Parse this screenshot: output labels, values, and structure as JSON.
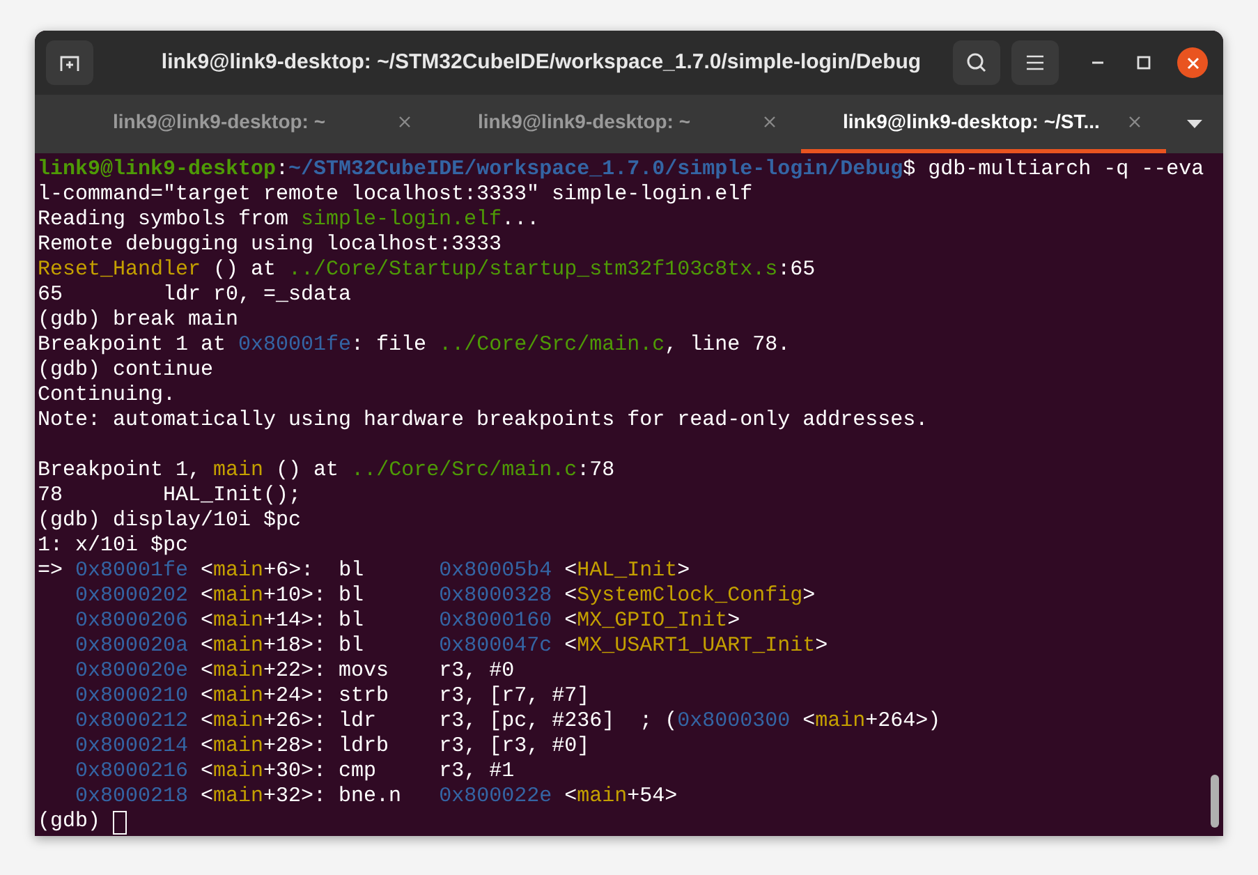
{
  "window": {
    "title": "link9@link9-desktop: ~/STM32CubeIDE/workspace_1.7.0/simple-login/Debug"
  },
  "tabs": [
    {
      "label": "link9@link9-desktop: ~",
      "selected": false
    },
    {
      "label": "link9@link9-desktop: ~",
      "selected": false
    },
    {
      "label": "link9@link9-desktop: ~/ST...",
      "selected": true
    }
  ],
  "terminal": {
    "lines": [
      {
        "kind": "text",
        "segments": [
          {
            "kind": "user",
            "text": "link9@link9-desktop"
          },
          {
            "kind": "plain",
            "text": ":"
          },
          {
            "kind": "path",
            "text": "~/STM32CubeIDE/workspace_1.7.0/simple-login/Debug"
          },
          {
            "kind": "plain",
            "text": "$ gdb-multiarch -q --eva"
          }
        ]
      },
      {
        "kind": "text",
        "segments": [
          {
            "kind": "plain",
            "text": "l-command=\"target remote localhost:3333\" simple-login.elf"
          }
        ]
      },
      {
        "kind": "text",
        "segments": [
          {
            "kind": "plain",
            "text": "Reading symbols from "
          },
          {
            "kind": "file",
            "text": "simple-login.elf"
          },
          {
            "kind": "plain",
            "text": "..."
          }
        ]
      },
      {
        "kind": "text",
        "segments": [
          {
            "kind": "plain",
            "text": "Remote debugging using localhost:3333"
          }
        ]
      },
      {
        "kind": "text",
        "segments": [
          {
            "kind": "symbol",
            "text": "Reset_Handler"
          },
          {
            "kind": "plain",
            "text": " () at "
          },
          {
            "kind": "file",
            "text": "../Core/Startup/startup_stm32f103c8tx.s"
          },
          {
            "kind": "plain",
            "text": ":65"
          }
        ]
      },
      {
        "kind": "text",
        "segments": [
          {
            "kind": "plain",
            "text": "65        ldr r0, =_sdata"
          }
        ]
      },
      {
        "kind": "text",
        "segments": [
          {
            "kind": "plain",
            "text": "(gdb) break main"
          }
        ]
      },
      {
        "kind": "text",
        "segments": [
          {
            "kind": "plain",
            "text": "Breakpoint 1 at "
          },
          {
            "kind": "address",
            "text": "0x80001fe"
          },
          {
            "kind": "plain",
            "text": ": file "
          },
          {
            "kind": "file",
            "text": "../Core/Src/main.c"
          },
          {
            "kind": "plain",
            "text": ", line 78."
          }
        ]
      },
      {
        "kind": "text",
        "segments": [
          {
            "kind": "plain",
            "text": "(gdb) continue"
          }
        ]
      },
      {
        "kind": "text",
        "segments": [
          {
            "kind": "plain",
            "text": "Continuing."
          }
        ]
      },
      {
        "kind": "text",
        "segments": [
          {
            "kind": "plain",
            "text": "Note: automatically using hardware breakpoints for read-only addresses."
          }
        ]
      },
      {
        "kind": "blank"
      },
      {
        "kind": "text",
        "segments": [
          {
            "kind": "plain",
            "text": "Breakpoint 1, "
          },
          {
            "kind": "symbol",
            "text": "main"
          },
          {
            "kind": "plain",
            "text": " () at "
          },
          {
            "kind": "file",
            "text": "../Core/Src/main.c"
          },
          {
            "kind": "plain",
            "text": ":78"
          }
        ]
      },
      {
        "kind": "text",
        "segments": [
          {
            "kind": "plain",
            "text": "78        HAL_Init();"
          }
        ]
      },
      {
        "kind": "text",
        "segments": [
          {
            "kind": "plain",
            "text": "(gdb) display/10i $pc"
          }
        ]
      },
      {
        "kind": "text",
        "segments": [
          {
            "kind": "plain",
            "text": "1: x/10i $pc"
          }
        ]
      },
      {
        "kind": "text",
        "segments": [
          {
            "kind": "plain",
            "text": "=> "
          },
          {
            "kind": "address",
            "text": "0x80001fe"
          },
          {
            "kind": "plain",
            "text": " <"
          },
          {
            "kind": "symbol",
            "text": "main"
          },
          {
            "kind": "plain",
            "text": "+6>:  bl      "
          },
          {
            "kind": "address",
            "text": "0x80005b4"
          },
          {
            "kind": "plain",
            "text": " <"
          },
          {
            "kind": "symbol",
            "text": "HAL_Init"
          },
          {
            "kind": "plain",
            "text": ">"
          }
        ]
      },
      {
        "kind": "indented",
        "segments": [
          {
            "kind": "address",
            "text": "0x8000202"
          },
          {
            "kind": "plain",
            "text": " <"
          },
          {
            "kind": "symbol",
            "text": "main"
          },
          {
            "kind": "plain",
            "text": "+10>: bl      "
          },
          {
            "kind": "address",
            "text": "0x8000328"
          },
          {
            "kind": "plain",
            "text": " <"
          },
          {
            "kind": "symbol",
            "text": "SystemClock_Config"
          },
          {
            "kind": "plain",
            "text": ">"
          }
        ]
      },
      {
        "kind": "indented",
        "segments": [
          {
            "kind": "address",
            "text": "0x8000206"
          },
          {
            "kind": "plain",
            "text": " <"
          },
          {
            "kind": "symbol",
            "text": "main"
          },
          {
            "kind": "plain",
            "text": "+14>: bl      "
          },
          {
            "kind": "address",
            "text": "0x8000160"
          },
          {
            "kind": "plain",
            "text": " <"
          },
          {
            "kind": "symbol",
            "text": "MX_GPIO_Init"
          },
          {
            "kind": "plain",
            "text": ">"
          }
        ]
      },
      {
        "kind": "indented",
        "segments": [
          {
            "kind": "address",
            "text": "0x800020a"
          },
          {
            "kind": "plain",
            "text": " <"
          },
          {
            "kind": "symbol",
            "text": "main"
          },
          {
            "kind": "plain",
            "text": "+18>: bl      "
          },
          {
            "kind": "address",
            "text": "0x800047c"
          },
          {
            "kind": "plain",
            "text": " <"
          },
          {
            "kind": "symbol",
            "text": "MX_USART1_UART_Init"
          },
          {
            "kind": "plain",
            "text": ">"
          }
        ]
      },
      {
        "kind": "indented",
        "segments": [
          {
            "kind": "address",
            "text": "0x800020e"
          },
          {
            "kind": "plain",
            "text": " <"
          },
          {
            "kind": "symbol",
            "text": "main"
          },
          {
            "kind": "plain",
            "text": "+22>: movs    r3, #0"
          }
        ]
      },
      {
        "kind": "indented",
        "segments": [
          {
            "kind": "address",
            "text": "0x8000210"
          },
          {
            "kind": "plain",
            "text": " <"
          },
          {
            "kind": "symbol",
            "text": "main"
          },
          {
            "kind": "plain",
            "text": "+24>: strb    r3, [r7, #7]"
          }
        ]
      },
      {
        "kind": "indented",
        "segments": [
          {
            "kind": "address",
            "text": "0x8000212"
          },
          {
            "kind": "plain",
            "text": " <"
          },
          {
            "kind": "symbol",
            "text": "main"
          },
          {
            "kind": "plain",
            "text": "+26>: ldr     r3, [pc, #236]  ; ("
          },
          {
            "kind": "address",
            "text": "0x8000300"
          },
          {
            "kind": "plain",
            "text": " <"
          },
          {
            "kind": "symbol",
            "text": "main"
          },
          {
            "kind": "plain",
            "text": "+264>)"
          }
        ]
      },
      {
        "kind": "indented",
        "segments": [
          {
            "kind": "address",
            "text": "0x8000214"
          },
          {
            "kind": "plain",
            "text": " <"
          },
          {
            "kind": "symbol",
            "text": "main"
          },
          {
            "kind": "plain",
            "text": "+28>: ldrb    r3, [r3, #0]"
          }
        ]
      },
      {
        "kind": "indented",
        "segments": [
          {
            "kind": "address",
            "text": "0x8000216"
          },
          {
            "kind": "plain",
            "text": " <"
          },
          {
            "kind": "symbol",
            "text": "main"
          },
          {
            "kind": "plain",
            "text": "+30>: cmp     r3, #1"
          }
        ]
      },
      {
        "kind": "indented",
        "segments": [
          {
            "kind": "address",
            "text": "0x8000218"
          },
          {
            "kind": "plain",
            "text": " <"
          },
          {
            "kind": "symbol",
            "text": "main"
          },
          {
            "kind": "plain",
            "text": "+32>: bne.n   "
          },
          {
            "kind": "address",
            "text": "0x800022e"
          },
          {
            "kind": "plain",
            "text": " <"
          },
          {
            "kind": "symbol",
            "text": "main"
          },
          {
            "kind": "plain",
            "text": "+54>"
          }
        ]
      },
      {
        "kind": "prompt",
        "segments": [
          {
            "kind": "plain",
            "text": "(gdb) "
          }
        ]
      }
    ]
  }
}
